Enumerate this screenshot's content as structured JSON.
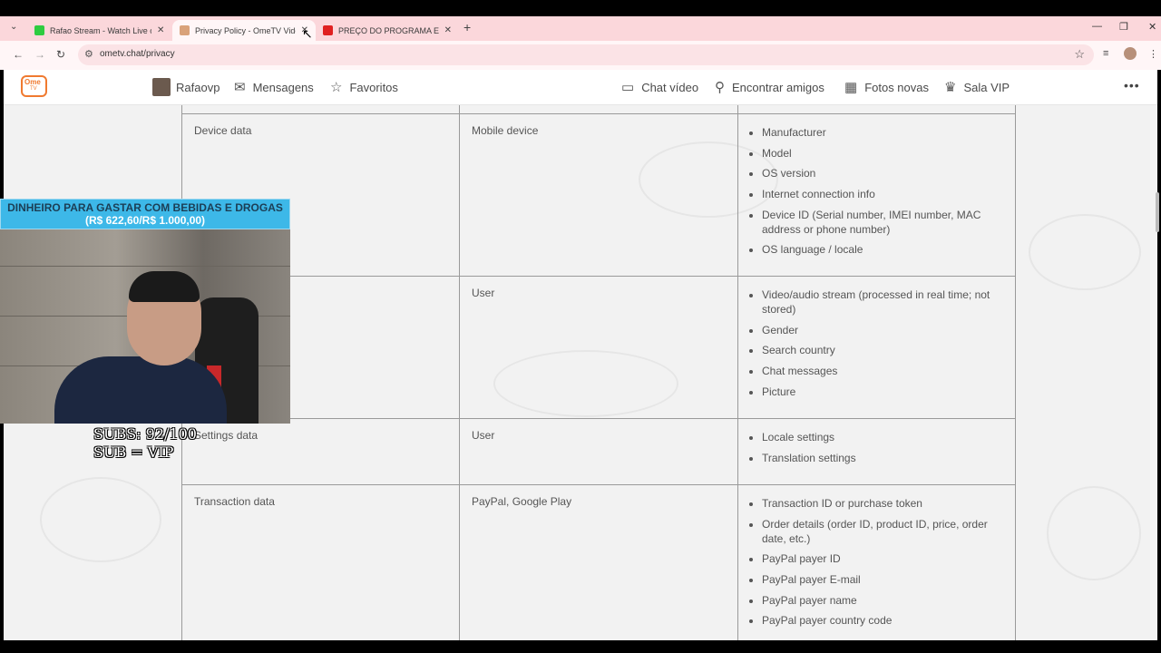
{
  "browser": {
    "tabs": [
      {
        "title": "Rafao Stream - Watch Live on K",
        "favicon_color": "#2ecc40"
      },
      {
        "title": "Privacy Policy - OmeTV Video C",
        "favicon_color": "#d9a27a"
      },
      {
        "title": "PREÇO DO PROGRAMA E DA C",
        "favicon_color": "#e02020"
      }
    ],
    "url": "ometv.chat/privacy"
  },
  "site": {
    "logo_top": "Ome",
    "logo_bottom": "TV",
    "nav_left": [
      {
        "label": "Rafaovp"
      },
      {
        "label": "Mensagens",
        "icon": "envelope-icon"
      },
      {
        "label": "Favoritos",
        "icon": "star-icon"
      }
    ],
    "nav_right": [
      {
        "label": "Chat vídeo",
        "icon": "tv-icon"
      },
      {
        "label": "Encontrar amigos",
        "icon": "search-icon"
      },
      {
        "label": "Fotos novas",
        "icon": "calendar-icon"
      },
      {
        "label": "Sala VIP",
        "icon": "crown-icon"
      }
    ]
  },
  "table": {
    "rows": [
      {
        "category": "Device data",
        "source": "Mobile device",
        "items": [
          "Manufacturer",
          "Model",
          "OS version",
          "Internet connection info",
          "Device ID (Serial number, IMEI number, MAC address or phone number)",
          "OS language / locale"
        ]
      },
      {
        "category": "",
        "source": "User",
        "items": [
          "Video/audio stream (processed in real time; not stored)",
          "Gender",
          "Search country",
          "Chat messages",
          "Picture"
        ]
      },
      {
        "category": "Settings data",
        "source": "User",
        "items": [
          "Locale settings",
          "Translation settings"
        ]
      },
      {
        "category": "Transaction data",
        "source": "PayPal, Google Play",
        "items": [
          "Transaction ID or purchase token",
          "Order details (order ID, product ID, price, order date, etc.)",
          "PayPal payer ID",
          "PayPal payer E-mail",
          "PayPal payer name",
          "PayPal payer country code"
        ]
      }
    ]
  },
  "overlay": {
    "banner_line1": "DINHEIRO PARA GASTAR COM BEBIDAS E DROGAS",
    "banner_line2": "(R$ 622,60/R$ 1.000,00)",
    "subs_line1": "SUBS: 92/100",
    "subs_line2": "SUB = VIP"
  }
}
